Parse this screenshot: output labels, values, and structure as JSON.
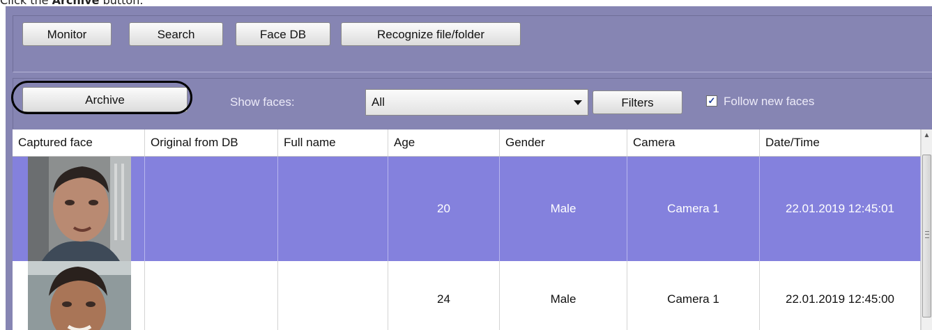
{
  "instruction": {
    "prefix": "Click the ",
    "bold": "Archive",
    "suffix": " button."
  },
  "toolbar": {
    "monitor_label": "Monitor",
    "search_label": "Search",
    "facedb_label": "Face DB",
    "recognize_label": "Recognize file/folder"
  },
  "filterbar": {
    "archive_label": "Archive",
    "show_faces_label": "Show faces:",
    "show_faces_value": "All",
    "filters_label": "Filters",
    "follow_label": "Follow new faces",
    "follow_checked": "✓"
  },
  "table": {
    "columns": [
      "Captured face",
      "Original from DB",
      "Full name",
      "Age",
      "Gender",
      "Camera",
      "Date/Time"
    ],
    "rows": [
      {
        "age": "20",
        "gender": "Male",
        "camera": "Camera 1",
        "datetime": "22.01.2019 12:45:01"
      },
      {
        "age": "24",
        "gender": "Male",
        "camera": "Camera 1",
        "datetime": "22.01.2019 12:45:00"
      }
    ]
  },
  "colors": {
    "app_bg": "#8685b3",
    "selected_row": "#8481dd"
  }
}
